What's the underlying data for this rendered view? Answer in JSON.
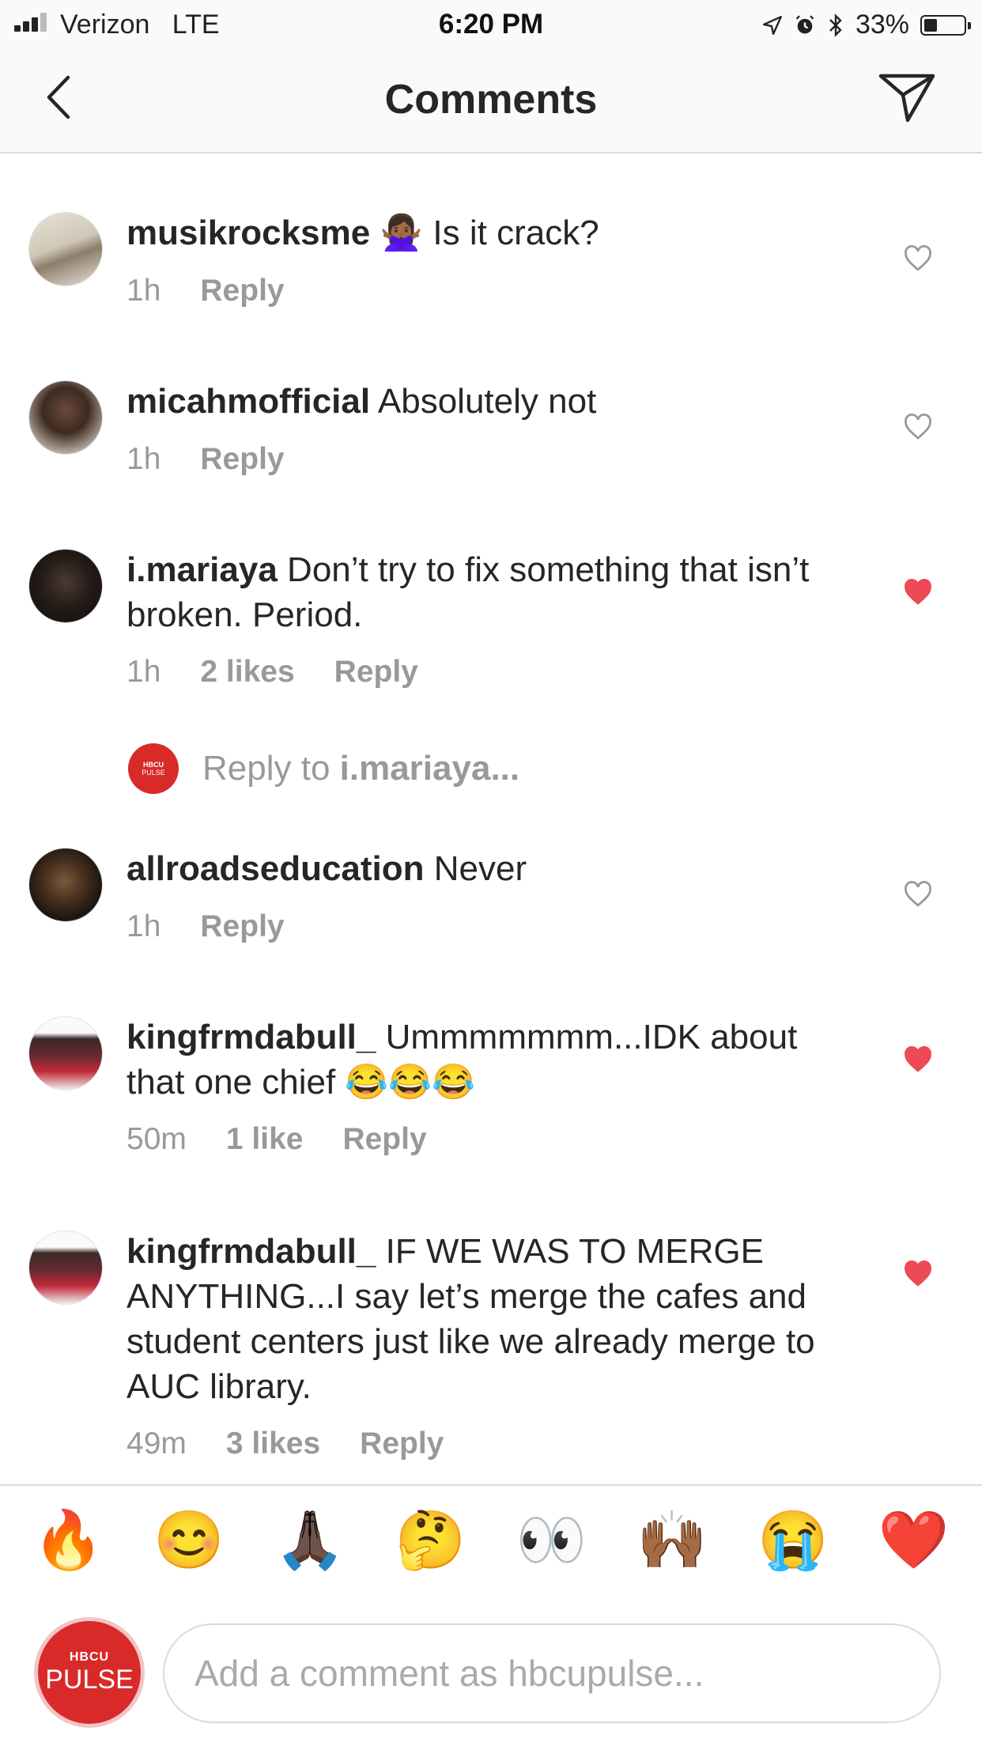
{
  "status": {
    "carrier": "Verizon",
    "network": "LTE",
    "time": "6:20 PM",
    "battery": "33%"
  },
  "nav": {
    "title": "Comments",
    "back_icon": "chevron-left-icon",
    "send_icon": "paper-plane-icon"
  },
  "comments": [
    {
      "user": "musikrocksme",
      "text": " 🙅🏾‍♀️ Is it crack?",
      "time": "1h",
      "likes": "",
      "reply": "Reply",
      "liked": false
    },
    {
      "user": "micahmofficial",
      "text": " Absolutely not",
      "time": "1h",
      "likes": "",
      "reply": "Reply",
      "liked": false
    },
    {
      "user": "i.mariaya",
      "text": " Don’t try to fix something that isn’t broken. Period.",
      "time": "1h",
      "likes": "2 likes",
      "reply": "Reply",
      "liked": true
    },
    {
      "user": "allroadseducation",
      "text": " Never",
      "time": "1h",
      "likes": "",
      "reply": "Reply",
      "liked": false
    },
    {
      "user": "kingfrmdabull_",
      "text": " Ummmmmmm...IDK about that one chief 😂😂😂",
      "time": "50m",
      "likes": "1 like",
      "reply": "Reply",
      "liked": true
    },
    {
      "user": "kingfrmdabull_",
      "text": " IF WE WAS TO MERGE ANYTHING...I say let’s merge the cafes and student centers just like we already merge to AUC library.",
      "time": "49m",
      "likes": "3 likes",
      "reply": "Reply",
      "liked": true
    }
  ],
  "reply_thread": {
    "prefix": "Reply to ",
    "user": "i.mariaya...",
    "avatar_small": "HBCU",
    "avatar_large": "PULSE"
  },
  "emoji_bar": [
    "🔥",
    "😊",
    "🙏🏿",
    "🤔",
    "👀",
    "🙌🏾",
    "😭",
    "❤️"
  ],
  "composer": {
    "avatar_small": "HBCU",
    "avatar_large": "PULSE",
    "placeholder": "Add a comment as hbcupulse..."
  },
  "colors": {
    "heart_liked": "#ed4956",
    "heart_outline": "#999999",
    "brand_red": "#d92a2a"
  }
}
